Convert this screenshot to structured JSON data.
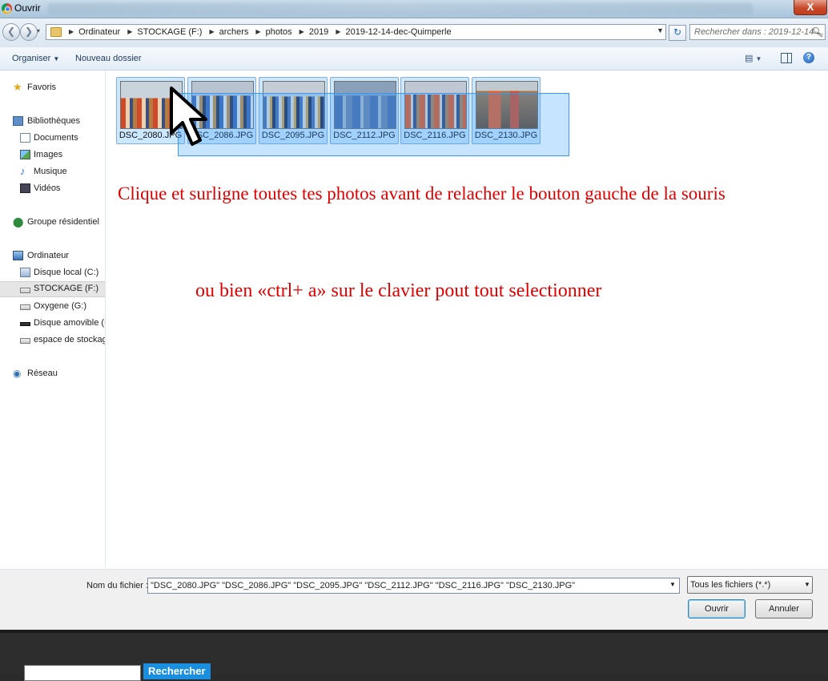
{
  "window": {
    "title": "Ouvrir",
    "close_label": "X",
    "close_color": "#c74a2b"
  },
  "address_bar": {
    "crumbs": [
      "Ordinateur",
      "STOCKAGE (F:)",
      "archers",
      "photos",
      "2019",
      "2019-12-14-dec-Quimperle"
    ],
    "search_placeholder": "Rechercher dans : 2019-12-14-..."
  },
  "toolbar": {
    "organize_label": "Organiser",
    "new_folder_label": "Nouveau dossier"
  },
  "nav": {
    "favorites": "Favoris",
    "libraries": "Bibliothèques",
    "documents": "Documents",
    "images": "Images",
    "music": "Musique",
    "videos": "Vidéos",
    "homegroup": "Groupe résidentiel",
    "computer": "Ordinateur",
    "drive_c": "Disque local (C:)",
    "drive_f": "STOCKAGE (F:)",
    "drive_g": "Oxygene (G:)",
    "drive_h": "Disque amovible (H:",
    "storage": "espace de stockage",
    "network": "Réseau",
    "selected_item": "STOCKAGE (F:)"
  },
  "files": [
    {
      "name": "DSC_2080.JPG",
      "selected": true
    },
    {
      "name": "DSC_2086.JPG",
      "selected": true
    },
    {
      "name": "DSC_2095.JPG",
      "selected": true
    },
    {
      "name": "DSC_2112.JPG",
      "selected": true
    },
    {
      "name": "DSC_2116.JPG",
      "selected": true
    },
    {
      "name": "DSC_2130.JPG",
      "selected": true
    }
  ],
  "annotations": {
    "line1": "Clique et surligne toutes tes photos avant de relacher le bouton gauche de la souris",
    "line2": "ou bien «ctrl+ a» sur le clavier pout tout selectionner",
    "color": "#e00000"
  },
  "footer": {
    "filename_label": "Nom du fichier :",
    "filename_value": "\"DSC_2080.JPG\" \"DSC_2086.JPG\" \"DSC_2095.JPG\" \"DSC_2112.JPG\" \"DSC_2116.JPG\" \"DSC_2130.JPG\"",
    "filetype_value": "Tous les fichiers (*.*)",
    "open_label": "Ouvrir",
    "cancel_label": "Annuler"
  },
  "background_page": {
    "search_button_label": "Rechercher",
    "accent": "#1a8fe0"
  }
}
